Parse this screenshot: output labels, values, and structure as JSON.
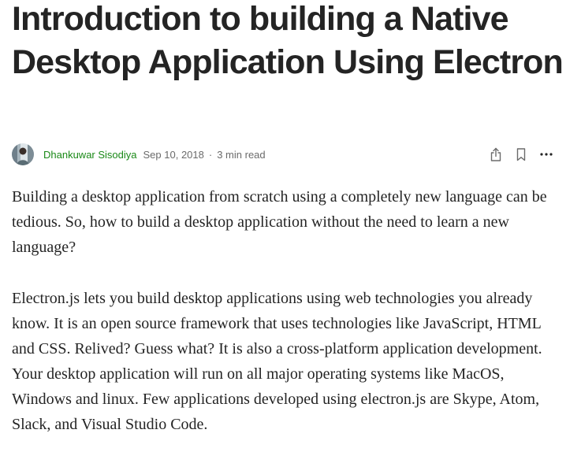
{
  "article": {
    "title": "Introduction to building a Native Desktop Application Using Electron",
    "author": "Dhankuwar Sisodiya",
    "date": "Sep 10, 2018",
    "separator": "·",
    "read_time": "3 min read",
    "paragraphs": [
      "Building a desktop application from scratch using a completely new language can be tedious. So, how to build a desktop application without the need to learn a new language?",
      "Electron.js lets you build desktop applications using web technologies you already know. It is an open source framework that uses technologies like JavaScript, HTML and CSS. Relived? Guess what? It is also a cross-platform application development. Your desktop application will run on all major operating systems like MacOS, Windows and linux. Few applications developed using electron.js are Skype, Atom, Slack, and Visual Studio Code."
    ]
  },
  "icons": {
    "share": "share-icon",
    "bookmark": "bookmark-icon",
    "more": "more-icon"
  },
  "colors": {
    "text": "#242424",
    "author": "#1a8917",
    "muted": "#6b6b6b"
  }
}
